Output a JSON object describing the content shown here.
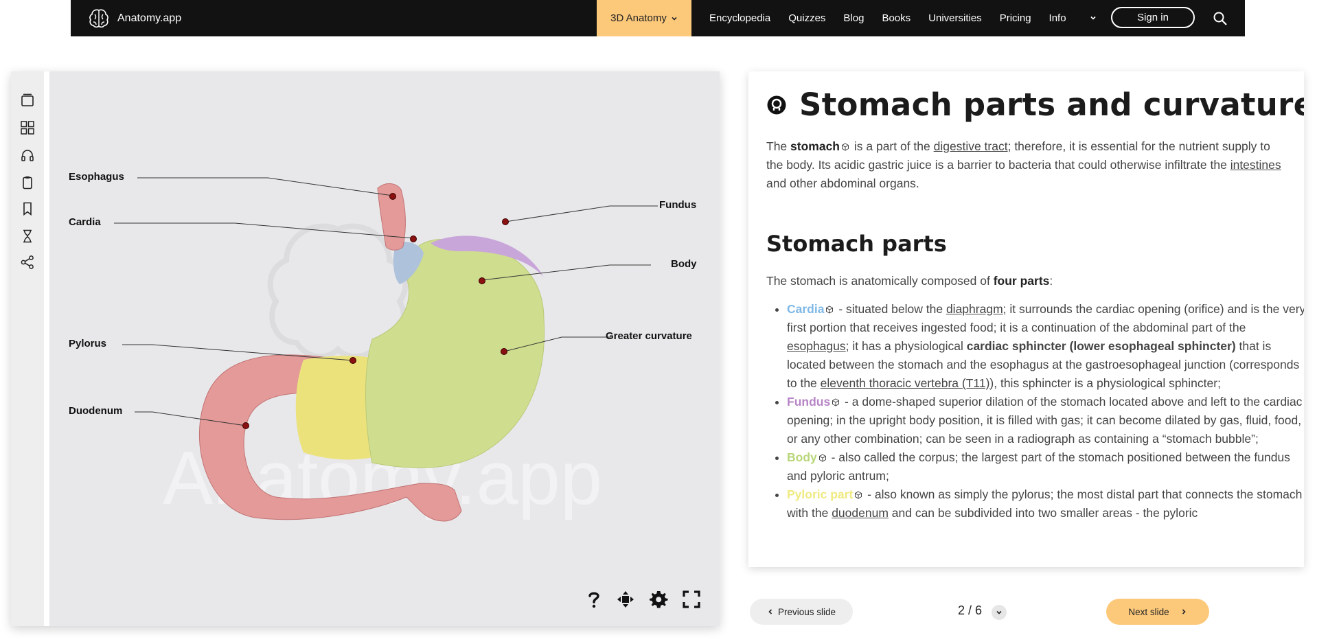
{
  "nav": {
    "brand": "Anatomy.app",
    "active_item": "3D Anatomy",
    "links": [
      "Encyclopedia",
      "Quizzes",
      "Blog",
      "Books",
      "Universities",
      "Pricing",
      "Info"
    ],
    "signin": "Sign in"
  },
  "viewer": {
    "labels": {
      "esophagus": "Esophagus",
      "cardia": "Cardia",
      "fundus": "Fundus",
      "body": "Body",
      "pylorus": "Pylorus",
      "greater_curvature": "Greater curvature",
      "duodenum": "Duodenum"
    },
    "watermark": "Anatomy.app"
  },
  "article": {
    "title": "Stomach parts and curvatures",
    "intro": {
      "t1": "The ",
      "b1": "stomach",
      "t2": " is a part of the ",
      "l1": "digestive tract",
      "t3": "; therefore, it is essential for the nutrient supply to the body. Its acidic gastric juice is a barrier to bacteria that could otherwise infiltrate the ",
      "l2": "intestines",
      "t4": " and other abdominal organs."
    },
    "section_title": "Stomach parts",
    "section_intro": {
      "t1": "The stomach is anatomically composed of ",
      "b1": "four parts",
      "t2": ":"
    },
    "parts": [
      {
        "name": "Cardia",
        "color": "#7fb8e6",
        "t1": " - situated below the ",
        "l1": "diaphragm",
        "t2": "; it surrounds the cardiac opening (orifice) and is the very first portion that receives ingested food; it is a continuation of the abdominal part of the ",
        "l2": "esophagus",
        "t3": "; it has a physiological ",
        "b1": "cardiac sphincter (lower esophageal sphincter)",
        "t4": " that is located between the stomach and the esophagus at the gastroesophageal junction (corresponds to the ",
        "l3": "eleventh thoracic vertebra (T11)",
        "t5": "), this sphincter is a physiological sphincter;"
      },
      {
        "name": "Fundus",
        "color": "#b785c6",
        "t1": " - a dome-shaped superior dilation of the stomach located above and left to the cardiac opening; in the upright body position, it is filled with gas; it can become dilated by gas, fluid, food, or any other combination; can be seen in a radiograph as containing a “stomach bubble”;"
      },
      {
        "name": "Body",
        "color": "#b8d67a",
        "t1": " - also called the corpus; the largest part of the stomach positioned between the fundus and pyloric antrum;"
      },
      {
        "name": "Pyloric part",
        "color": "#f0ea80",
        "t1": " - also known as simply the pylorus; the most distal part that connects the stomach with the ",
        "l1": "duodenum",
        "t2": " and can be subdivided into two smaller areas - the pyloric"
      }
    ]
  },
  "controls": {
    "prev": "Previous slide",
    "page": "2 / 6",
    "next": "Next slide"
  },
  "colors": {
    "accent": "#fcc97b",
    "nav_bg": "#121212"
  },
  "icons": [
    "brain-logo-icon",
    "chevron-down-icon",
    "search-icon",
    "layers-icon",
    "grid-icon",
    "headphones-icon",
    "clipboard-icon",
    "bookmark-icon",
    "hourglass-icon",
    "share-icon",
    "help-icon",
    "move-icon",
    "gear-icon",
    "fullscreen-icon",
    "open-3d-icon",
    "cube-icon",
    "chevron-left-icon",
    "chevron-right-icon"
  ]
}
